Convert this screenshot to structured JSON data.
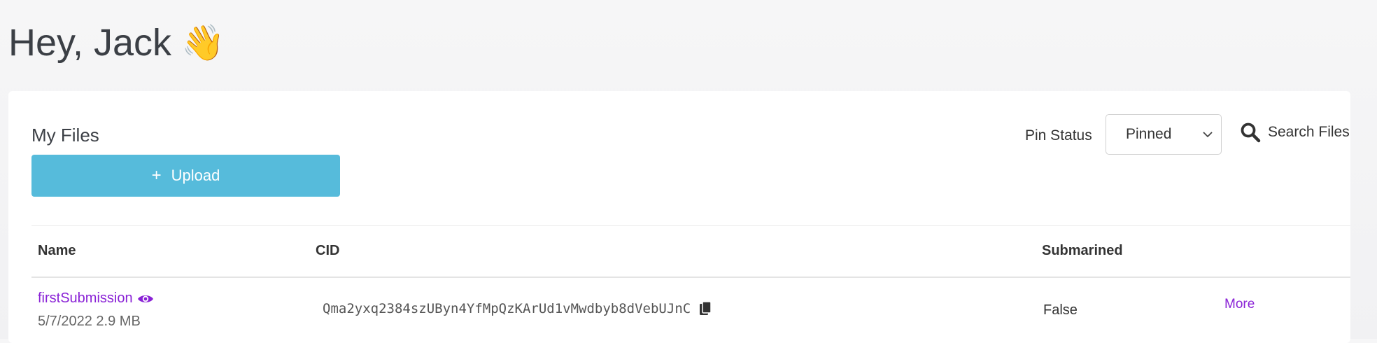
{
  "header": {
    "greeting": "Hey, Jack",
    "wave_emoji": "👋"
  },
  "files_panel": {
    "title": "My Files",
    "upload_label": "Upload",
    "pin_status_label": "Pin Status",
    "pin_status_selected": "Pinned",
    "search_label": "Search Files"
  },
  "table": {
    "columns": {
      "name": "Name",
      "cid": "CID",
      "submarined": "Submarined"
    },
    "rows": [
      {
        "name": "firstSubmission",
        "date": "5/7/2022",
        "size": "2.9 MB",
        "cid": "Qma2yxq2384szUByn4YfMpQzKArUd1vMwdbyb8dVebUJnC",
        "submarined": "False",
        "more_label": "More"
      }
    ]
  },
  "colors": {
    "accent": "#8a22d6",
    "upload_button": "#56bbdb"
  }
}
